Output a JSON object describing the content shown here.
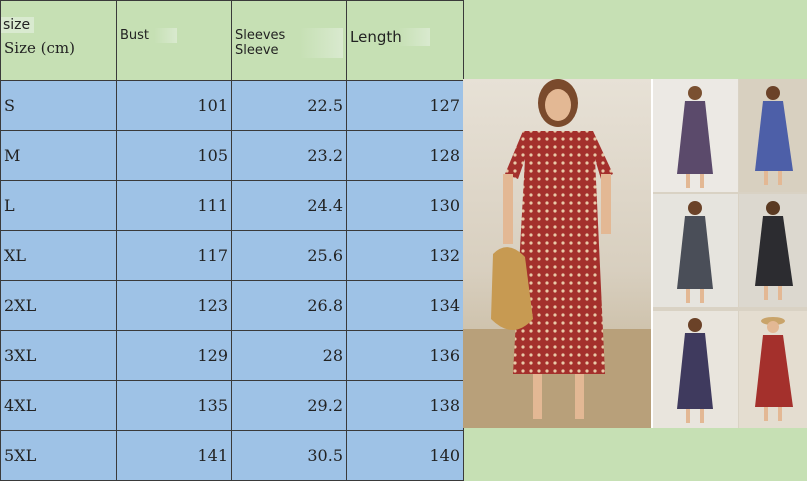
{
  "header": {
    "size_top": "size",
    "size_unit": "Size (cm)",
    "bust": "Bust",
    "sleeves": "Sleeves Sleeve",
    "length": "Length"
  },
  "rows": [
    {
      "size": "S",
      "bust": "101",
      "sleeve": "22.5",
      "length": "127"
    },
    {
      "size": "M",
      "bust": "105",
      "sleeve": "23.2",
      "length": "128"
    },
    {
      "size": "L",
      "bust": "111",
      "sleeve": "24.4",
      "length": "130"
    },
    {
      "size": "XL",
      "bust": "117",
      "sleeve": "25.6",
      "length": "132"
    },
    {
      "size": "2XL",
      "bust": "123",
      "sleeve": "26.8",
      "length": "134"
    },
    {
      "size": "3XL",
      "bust": "129",
      "sleeve": "28",
      "length": "136"
    },
    {
      "size": "4XL",
      "bust": "135",
      "sleeve": "29.2",
      "length": "138"
    },
    {
      "size": "5XL",
      "bust": "141",
      "sleeve": "30.5",
      "length": "140"
    }
  ],
  "colors": {
    "header_bg": "#c6e0b4",
    "row_bg": "#9ec2e6",
    "dress_red": "#a4302c",
    "dress_purple": "#5b4a6b",
    "dress_blue": "#4d5fa8",
    "dress_black": "#2c2c30"
  }
}
